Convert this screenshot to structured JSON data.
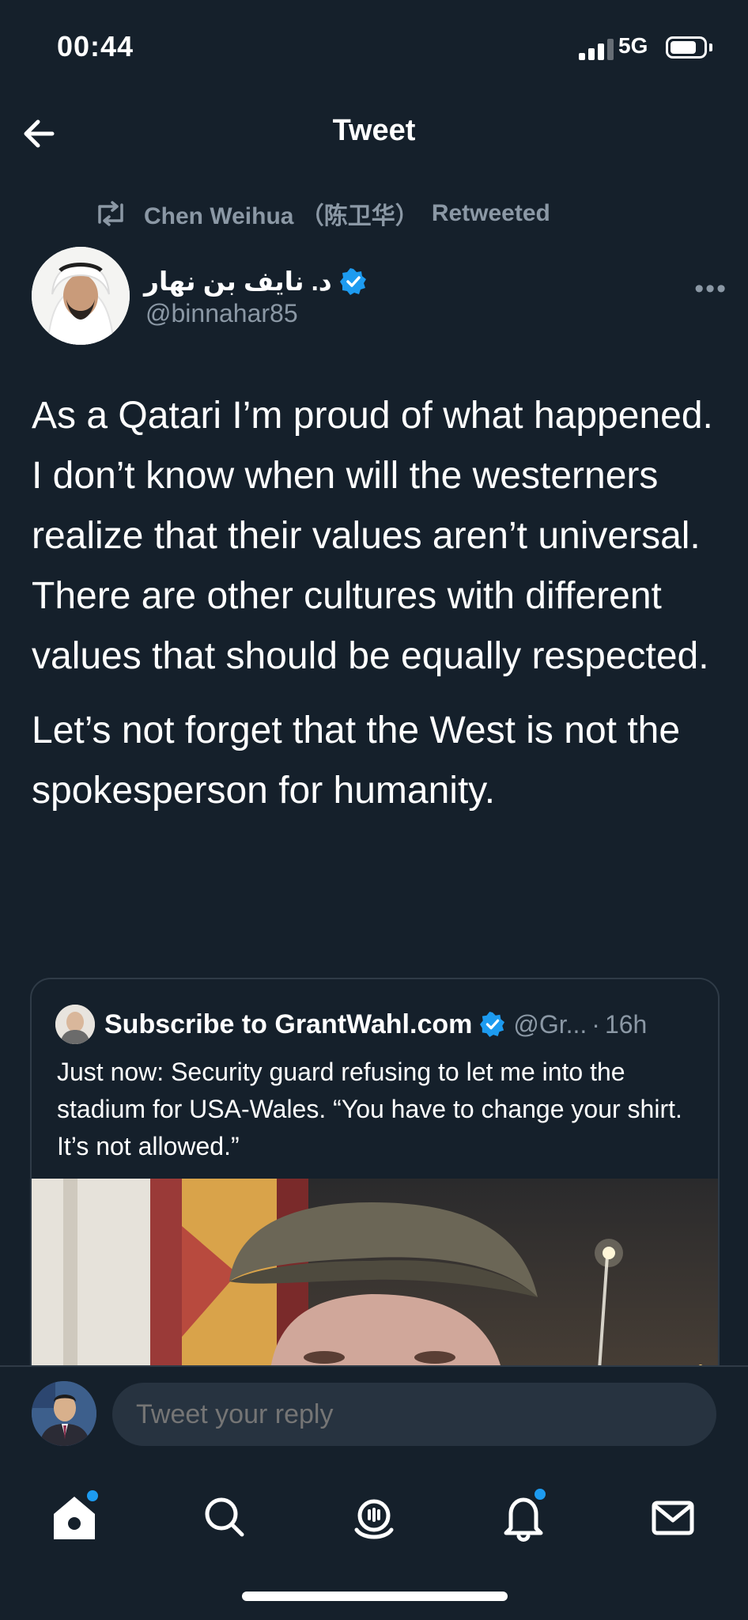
{
  "status_bar": {
    "time": "00:44",
    "network": "5G"
  },
  "header": {
    "title": "Tweet"
  },
  "retweet_context": {
    "user": "Chen Weihua （陈卫华）",
    "action": "Retweeted"
  },
  "author": {
    "display_name": "د. نايف بن نهار",
    "handle": "@binnahar85",
    "verified": true
  },
  "tweet": {
    "paragraph1_line1": "As a Qatari I’m proud of what happened.",
    "paragraph1_line2": "I don’t know when will the westerners realize that their values aren’t universal. There are other cultures with different values that should be equally respected.",
    "paragraph2": "Let’s not forget that the West is not the spokesperson for humanity."
  },
  "quoted_tweet": {
    "display_name": "Subscribe to GrantWahl.com",
    "handle": "@Gr...",
    "separator": "·",
    "time": "16h",
    "text": "Just now: Security guard refusing to let me into the stadium for USA-Wales. “You have to change your shirt. It’s not allowed.”"
  },
  "reply": {
    "placeholder": "Tweet your reply"
  },
  "tabbar": {
    "items": [
      {
        "icon": "home-icon",
        "notification_dot": true
      },
      {
        "icon": "search-icon",
        "notification_dot": false
      },
      {
        "icon": "spaces-icon",
        "notification_dot": false
      },
      {
        "icon": "bell-icon",
        "notification_dot": true
      },
      {
        "icon": "mail-icon",
        "notification_dot": false
      }
    ]
  },
  "colors": {
    "background": "#15202b",
    "accent": "#1d9bf0",
    "secondary_text": "#8b98a5",
    "border": "#2f3b47"
  }
}
